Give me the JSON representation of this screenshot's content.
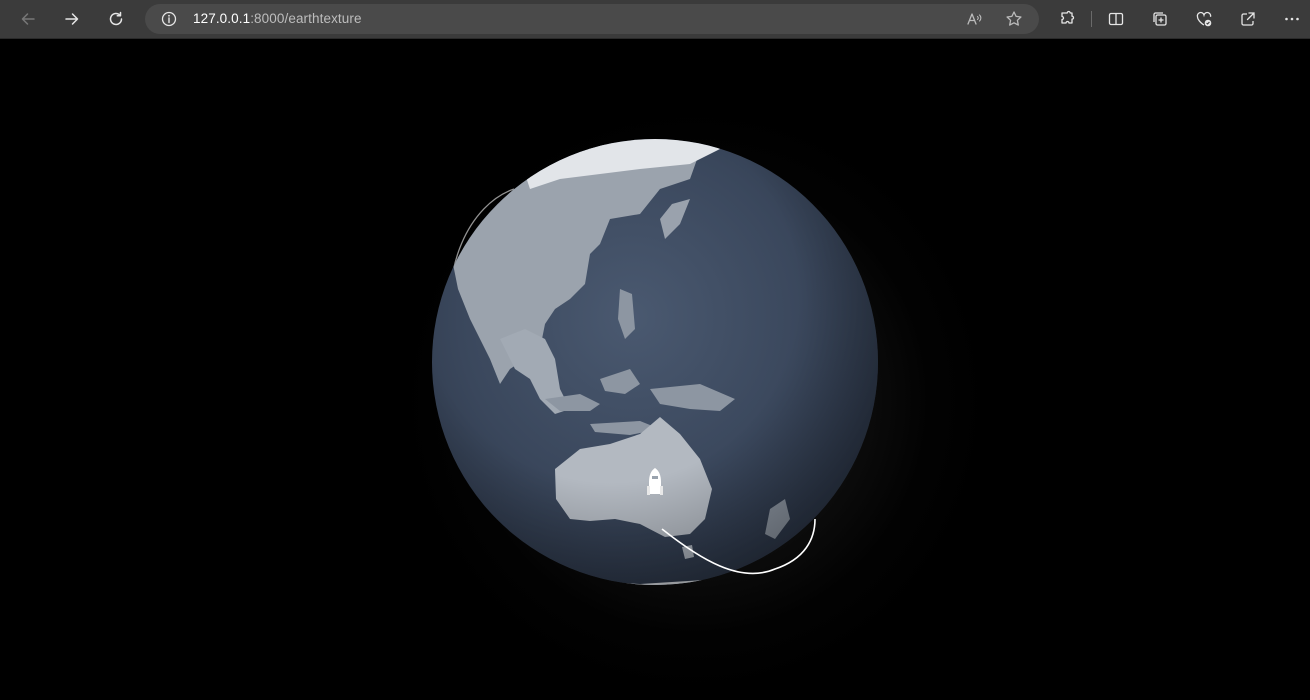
{
  "browser": {
    "url_host": "127.0.0.1",
    "url_rest": ":8000/earthtexture",
    "nav_icons": [
      "back-icon",
      "forward-icon",
      "refresh-icon"
    ],
    "address_icons": [
      "info-icon",
      "read-aloud-icon",
      "favorite-star-icon"
    ],
    "toolbar_icons": [
      "extensions-icon",
      "split-screen-icon",
      "collections-icon",
      "browser-essentials-icon",
      "share-icon",
      "more-menu-icon"
    ]
  },
  "scene": {
    "background": "#000000",
    "globe_color": "#3c4a60",
    "land_color": "#9aa3ae",
    "orbit_color": "#ffffff",
    "spacecraft_color": "#ffffff"
  }
}
